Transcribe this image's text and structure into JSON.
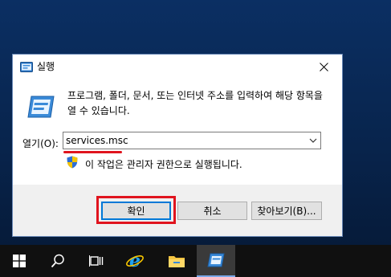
{
  "dialog": {
    "title": "실행",
    "description": "프로그램, 폴더, 문서, 또는 인터넷 주소를 입력하여 해당 항목을 열 수 있습니다.",
    "open_label": "열기(O):",
    "open_value": "services.msc",
    "admin_note": "이 작업은 관리자 권한으로 실행됩니다.",
    "ok_label": "확인",
    "cancel_label": "취소",
    "browse_label": "찾아보기(B)..."
  },
  "taskbar": {
    "items": [
      "start-icon",
      "search-icon",
      "task-view-icon",
      "internet-explorer-icon",
      "file-explorer-icon",
      "run-icon"
    ]
  },
  "colors": {
    "highlight": "#e0141e",
    "accent": "#0078d7"
  }
}
